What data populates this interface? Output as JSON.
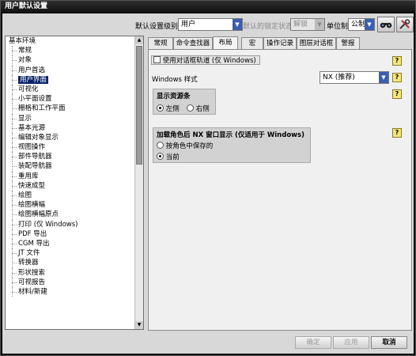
{
  "window": {
    "title": "用户默认设置"
  },
  "toolbar": {
    "level_label": "默认设置级别",
    "level_value": "用户",
    "lock_label": "默认的锁定状态",
    "lock_value": "解锁",
    "unit_label": "单位制",
    "unit_value": "公制"
  },
  "tree": {
    "items": [
      {
        "label": "基本环境",
        "level": 0
      },
      {
        "label": "常规",
        "level": 1
      },
      {
        "label": "对象",
        "level": 1
      },
      {
        "label": "用户首选",
        "level": 1
      },
      {
        "label": "用户界面",
        "level": 1,
        "selected": true
      },
      {
        "label": "可视化",
        "level": 1
      },
      {
        "label": "小平面设置",
        "level": 1
      },
      {
        "label": "栅格和工作平面",
        "level": 1
      },
      {
        "label": "显示",
        "level": 1
      },
      {
        "label": "基本光源",
        "level": 1
      },
      {
        "label": "编辑对象显示",
        "level": 1
      },
      {
        "label": "视图操作",
        "level": 1
      },
      {
        "label": "部件导航器",
        "level": 1
      },
      {
        "label": "装配导航器",
        "level": 1
      },
      {
        "label": "重用库",
        "level": 1
      },
      {
        "label": "快速成型",
        "level": 1
      },
      {
        "label": "绘图",
        "level": 1
      },
      {
        "label": "绘图横幅",
        "level": 1
      },
      {
        "label": "绘图横幅原点",
        "level": 1
      },
      {
        "label": "打印 (仅 Windows)",
        "level": 1
      },
      {
        "label": "PDF 导出",
        "level": 1
      },
      {
        "label": "CGM 导出",
        "level": 1
      },
      {
        "label": "JT 文件",
        "level": 1
      },
      {
        "label": "转换器",
        "level": 1
      },
      {
        "label": "形状搜索",
        "level": 1
      },
      {
        "label": "可视报告",
        "level": 1
      },
      {
        "label": "材料/新建",
        "level": 1
      }
    ]
  },
  "tabs": [
    {
      "label": "常规"
    },
    {
      "label": "命令查找器"
    },
    {
      "label": "布局",
      "active": true
    },
    {
      "label": "宏"
    },
    {
      "label": "操作记录"
    },
    {
      "label": "图层对话框"
    },
    {
      "label": "警报"
    }
  ],
  "panel": {
    "dialog_track_label": "使用对话框轨道 (仅 Windows)",
    "windows_style_label": "Windows 样式",
    "windows_style_value": "NX (推荐)",
    "resource_bar": {
      "title": "显示资源条",
      "left": "左侧",
      "right": "右侧",
      "selected": "left"
    },
    "restore": {
      "title": "加载角色后 NX 窗口显示 (仅适用于 Windows)",
      "option1": "按角色中保存的",
      "option2": "当前",
      "selected": "option2"
    },
    "help_symbol": "?"
  },
  "buttons": {
    "ok": "确定",
    "apply": "应用",
    "cancel": "取消"
  },
  "colors": {
    "selection": "#0a246a",
    "title_bar": "#1e1e1e",
    "combo_arrow": "#3a5fb0"
  }
}
